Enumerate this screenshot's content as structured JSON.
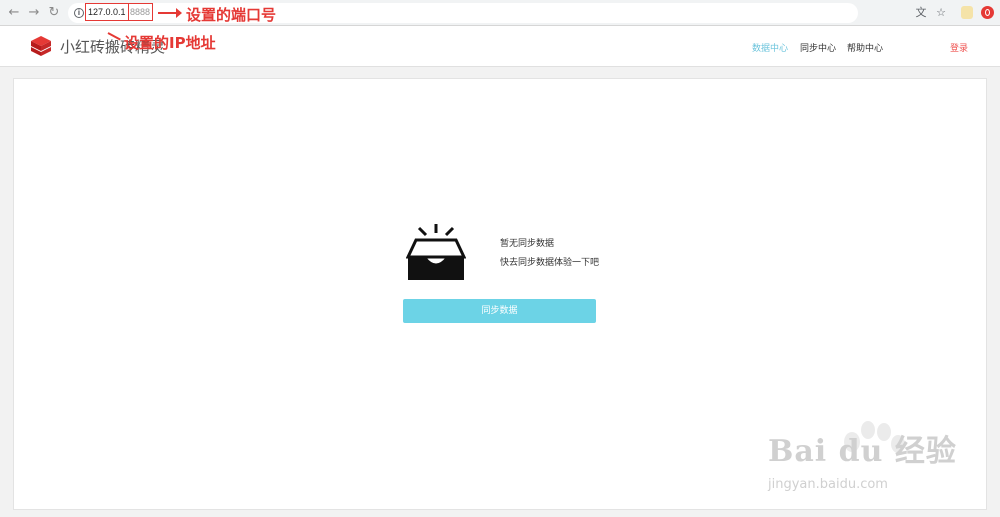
{
  "browser": {
    "url_host": "127.0.0.1",
    "url_port": "8888",
    "back_icon": "arrow-left-icon",
    "forward_icon": "arrow-right-icon",
    "reload_icon": "reload-icon"
  },
  "annotations": {
    "port_label": "设置的端口号",
    "ip_label": "设置的IP地址",
    "color": "#e53935"
  },
  "header": {
    "title": "小红砖搬砖精灵",
    "nav": [
      {
        "label": "数据中心",
        "active": true
      },
      {
        "label": "同步中心",
        "active": false
      },
      {
        "label": "帮助中心",
        "active": false
      }
    ],
    "login_label": "登录"
  },
  "main": {
    "empty_title": "暂无同步数据",
    "empty_subtitle": "快去同步数据体验一下吧",
    "sync_button_label": "同步数据",
    "accent_color": "#6cd3e6"
  },
  "watermark": {
    "text": "Bai du 经验",
    "subtext": "jingyan.baidu.com"
  }
}
